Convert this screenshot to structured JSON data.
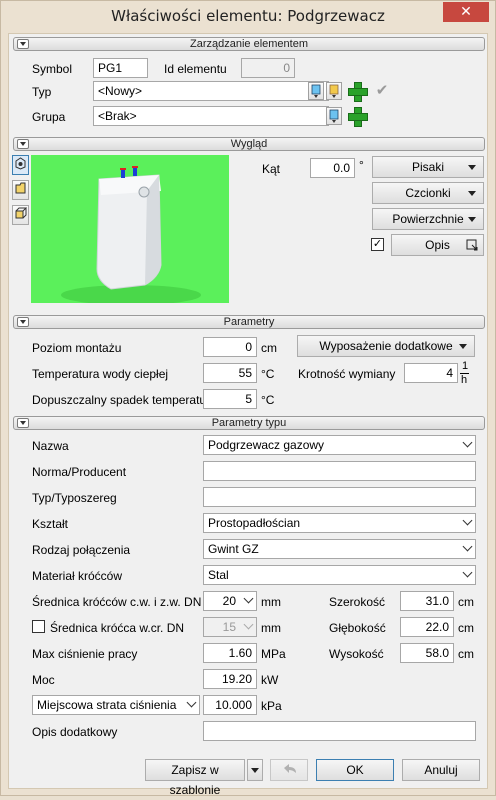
{
  "window": {
    "title": "Właściwości elementu: Podgrzewacz",
    "close": "✕"
  },
  "sections": {
    "management": "Zarządzanie elementem",
    "appearance": "Wygląd",
    "parameters": "Parametry",
    "type_parameters": "Parametry typu"
  },
  "management": {
    "symbol_label": "Symbol",
    "symbol_value": "PG1",
    "id_label": "Id elementu",
    "id_value": "0",
    "type_label": "Typ",
    "type_value": "<Nowy>",
    "group_label": "Grupa",
    "group_value": "<Brak>"
  },
  "appearance": {
    "angle_label": "Kąt",
    "angle_value": "0.0",
    "angle_unit": "°",
    "pens_button": "Pisaki",
    "fonts_button": "Czcionki",
    "surfaces_button": "Powierzchnie",
    "description_checked": "✓",
    "description_button": "Opis"
  },
  "parameters": {
    "mount_level_label": "Poziom montażu",
    "mount_level_value": "0",
    "mount_level_unit": "cm",
    "extra_equipment_button": "Wyposażenie dodatkowe",
    "hot_water_temp_label": "Temperatura wody ciepłej",
    "hot_water_temp_value": "55",
    "hot_water_temp_unit": "°C",
    "exchange_rate_label": "Krotność wymiany",
    "exchange_rate_value": "4",
    "exchange_rate_unit_top": "1",
    "exchange_rate_unit_bottom": "h",
    "temp_drop_label": "Dopuszczalny spadek temperatury",
    "temp_drop_value": "5",
    "temp_drop_unit": "°C"
  },
  "type_parameters": {
    "name_label": "Nazwa",
    "name_value": "Podgrzewacz gazowy",
    "norm_label": "Norma/Producent",
    "norm_value": "",
    "series_label": "Typ/Typoszereg",
    "series_value": "",
    "shape_label": "Kształt",
    "shape_value": "Prostopadłościan",
    "connection_label": "Rodzaj połączenia",
    "connection_value": "Gwint GZ",
    "material_label": "Materiał króćców",
    "material_value": "Stal",
    "stub_diam_label": "Średnica króćców c.w. i z.w. DN",
    "stub_diam_value": "20",
    "stub_diam_unit": "mm",
    "width_label": "Szerokość",
    "width_value": "31.0",
    "width_unit": "cm",
    "cr_stub_label": "Średnica króćca w.cr. DN",
    "cr_stub_value": "15",
    "cr_stub_unit": "mm",
    "depth_label": "Głębokość",
    "depth_value": "22.0",
    "depth_unit": "cm",
    "max_pressure_label": "Max ciśnienie pracy",
    "max_pressure_value": "1.60",
    "max_pressure_unit": "MPa",
    "height_label": "Wysokość",
    "height_value": "58.0",
    "height_unit": "cm",
    "power_label": "Moc",
    "power_value": "19.20",
    "power_unit": "kW",
    "pressure_loss_combo": "Miejscowa strata ciśnienia",
    "pressure_loss_value": "10.000",
    "pressure_loss_unit": "kPa",
    "extra_desc_label": "Opis dodatkowy",
    "extra_desc_value": ""
  },
  "footer": {
    "save_template": "Zapisz w szablonie",
    "ok": "OK",
    "cancel": "Anuluj"
  },
  "colors": {
    "preview_bg": "#5bf05b",
    "accent_blue": "#3c7fb1",
    "plus_green": "#2aa22a"
  }
}
